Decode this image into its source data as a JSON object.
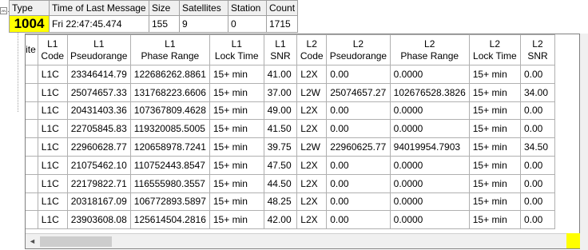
{
  "summary": {
    "headers": [
      "Type",
      "Time of Last Message",
      "Size",
      "Satellites",
      "Station",
      "Count"
    ],
    "values": [
      "1004",
      "Fri 22:47:45.474",
      "155",
      "9",
      "0",
      "1715"
    ],
    "type_color": "#ffff00"
  },
  "tree": {
    "collapse_glyph": "−"
  },
  "grid": {
    "columns": [
      [
        "",
        "ellite"
      ],
      [
        "L1",
        "Code"
      ],
      [
        "L1",
        "Pseudorange"
      ],
      [
        "L1",
        "Phase Range"
      ],
      [
        "L1",
        "Lock Time"
      ],
      [
        "L1",
        "SNR"
      ],
      [
        "L2",
        "Code"
      ],
      [
        "L2",
        "Pseudorange"
      ],
      [
        "L2",
        "Phase Range"
      ],
      [
        "L2",
        "Lock Time"
      ],
      [
        "L2",
        "SNR"
      ]
    ],
    "rows": [
      [
        "",
        "L1C",
        "23346414.79",
        "122686262.8861",
        "15+ min",
        "41.00",
        "L2X",
        "0.00",
        "0.0000",
        "15+ min",
        "0.00"
      ],
      [
        "",
        "L1C",
        "25074657.33",
        "131768223.6606",
        "15+ min",
        "37.00",
        "L2W",
        "25074657.27",
        "102676528.3826",
        "15+ min",
        "34.00"
      ],
      [
        "",
        "L1C",
        "20431403.36",
        "107367809.4628",
        "15+ min",
        "49.00",
        "L2X",
        "0.00",
        "0.0000",
        "15+ min",
        "0.00"
      ],
      [
        "",
        "L1C",
        "22705845.83",
        "119320085.5005",
        "15+ min",
        "41.50",
        "L2X",
        "0.00",
        "0.0000",
        "15+ min",
        "0.00"
      ],
      [
        "",
        "L1C",
        "22960628.77",
        "120658978.7241",
        "15+ min",
        "39.75",
        "L2W",
        "22960625.77",
        "94019954.7903",
        "15+ min",
        "34.50"
      ],
      [
        "",
        "L1C",
        "21075462.10",
        "110752443.8547",
        "15+ min",
        "47.50",
        "L2X",
        "0.00",
        "0.0000",
        "15+ min",
        "0.00"
      ],
      [
        "",
        "L1C",
        "22179822.71",
        "116555980.3557",
        "15+ min",
        "44.50",
        "L2X",
        "0.00",
        "0.0000",
        "15+ min",
        "0.00"
      ],
      [
        "",
        "L1C",
        "20318167.09",
        "106772893.5897",
        "15+ min",
        "48.25",
        "L2X",
        "0.00",
        "0.0000",
        "15+ min",
        "0.00"
      ],
      [
        "",
        "L1C",
        "23903608.08",
        "125614504.2816",
        "15+ min",
        "42.00",
        "L2X",
        "0.00",
        "0.0000",
        "15+ min",
        "0.00"
      ]
    ]
  },
  "scrollbar": {
    "left_arrow": "◄",
    "right_arrow": "►"
  }
}
